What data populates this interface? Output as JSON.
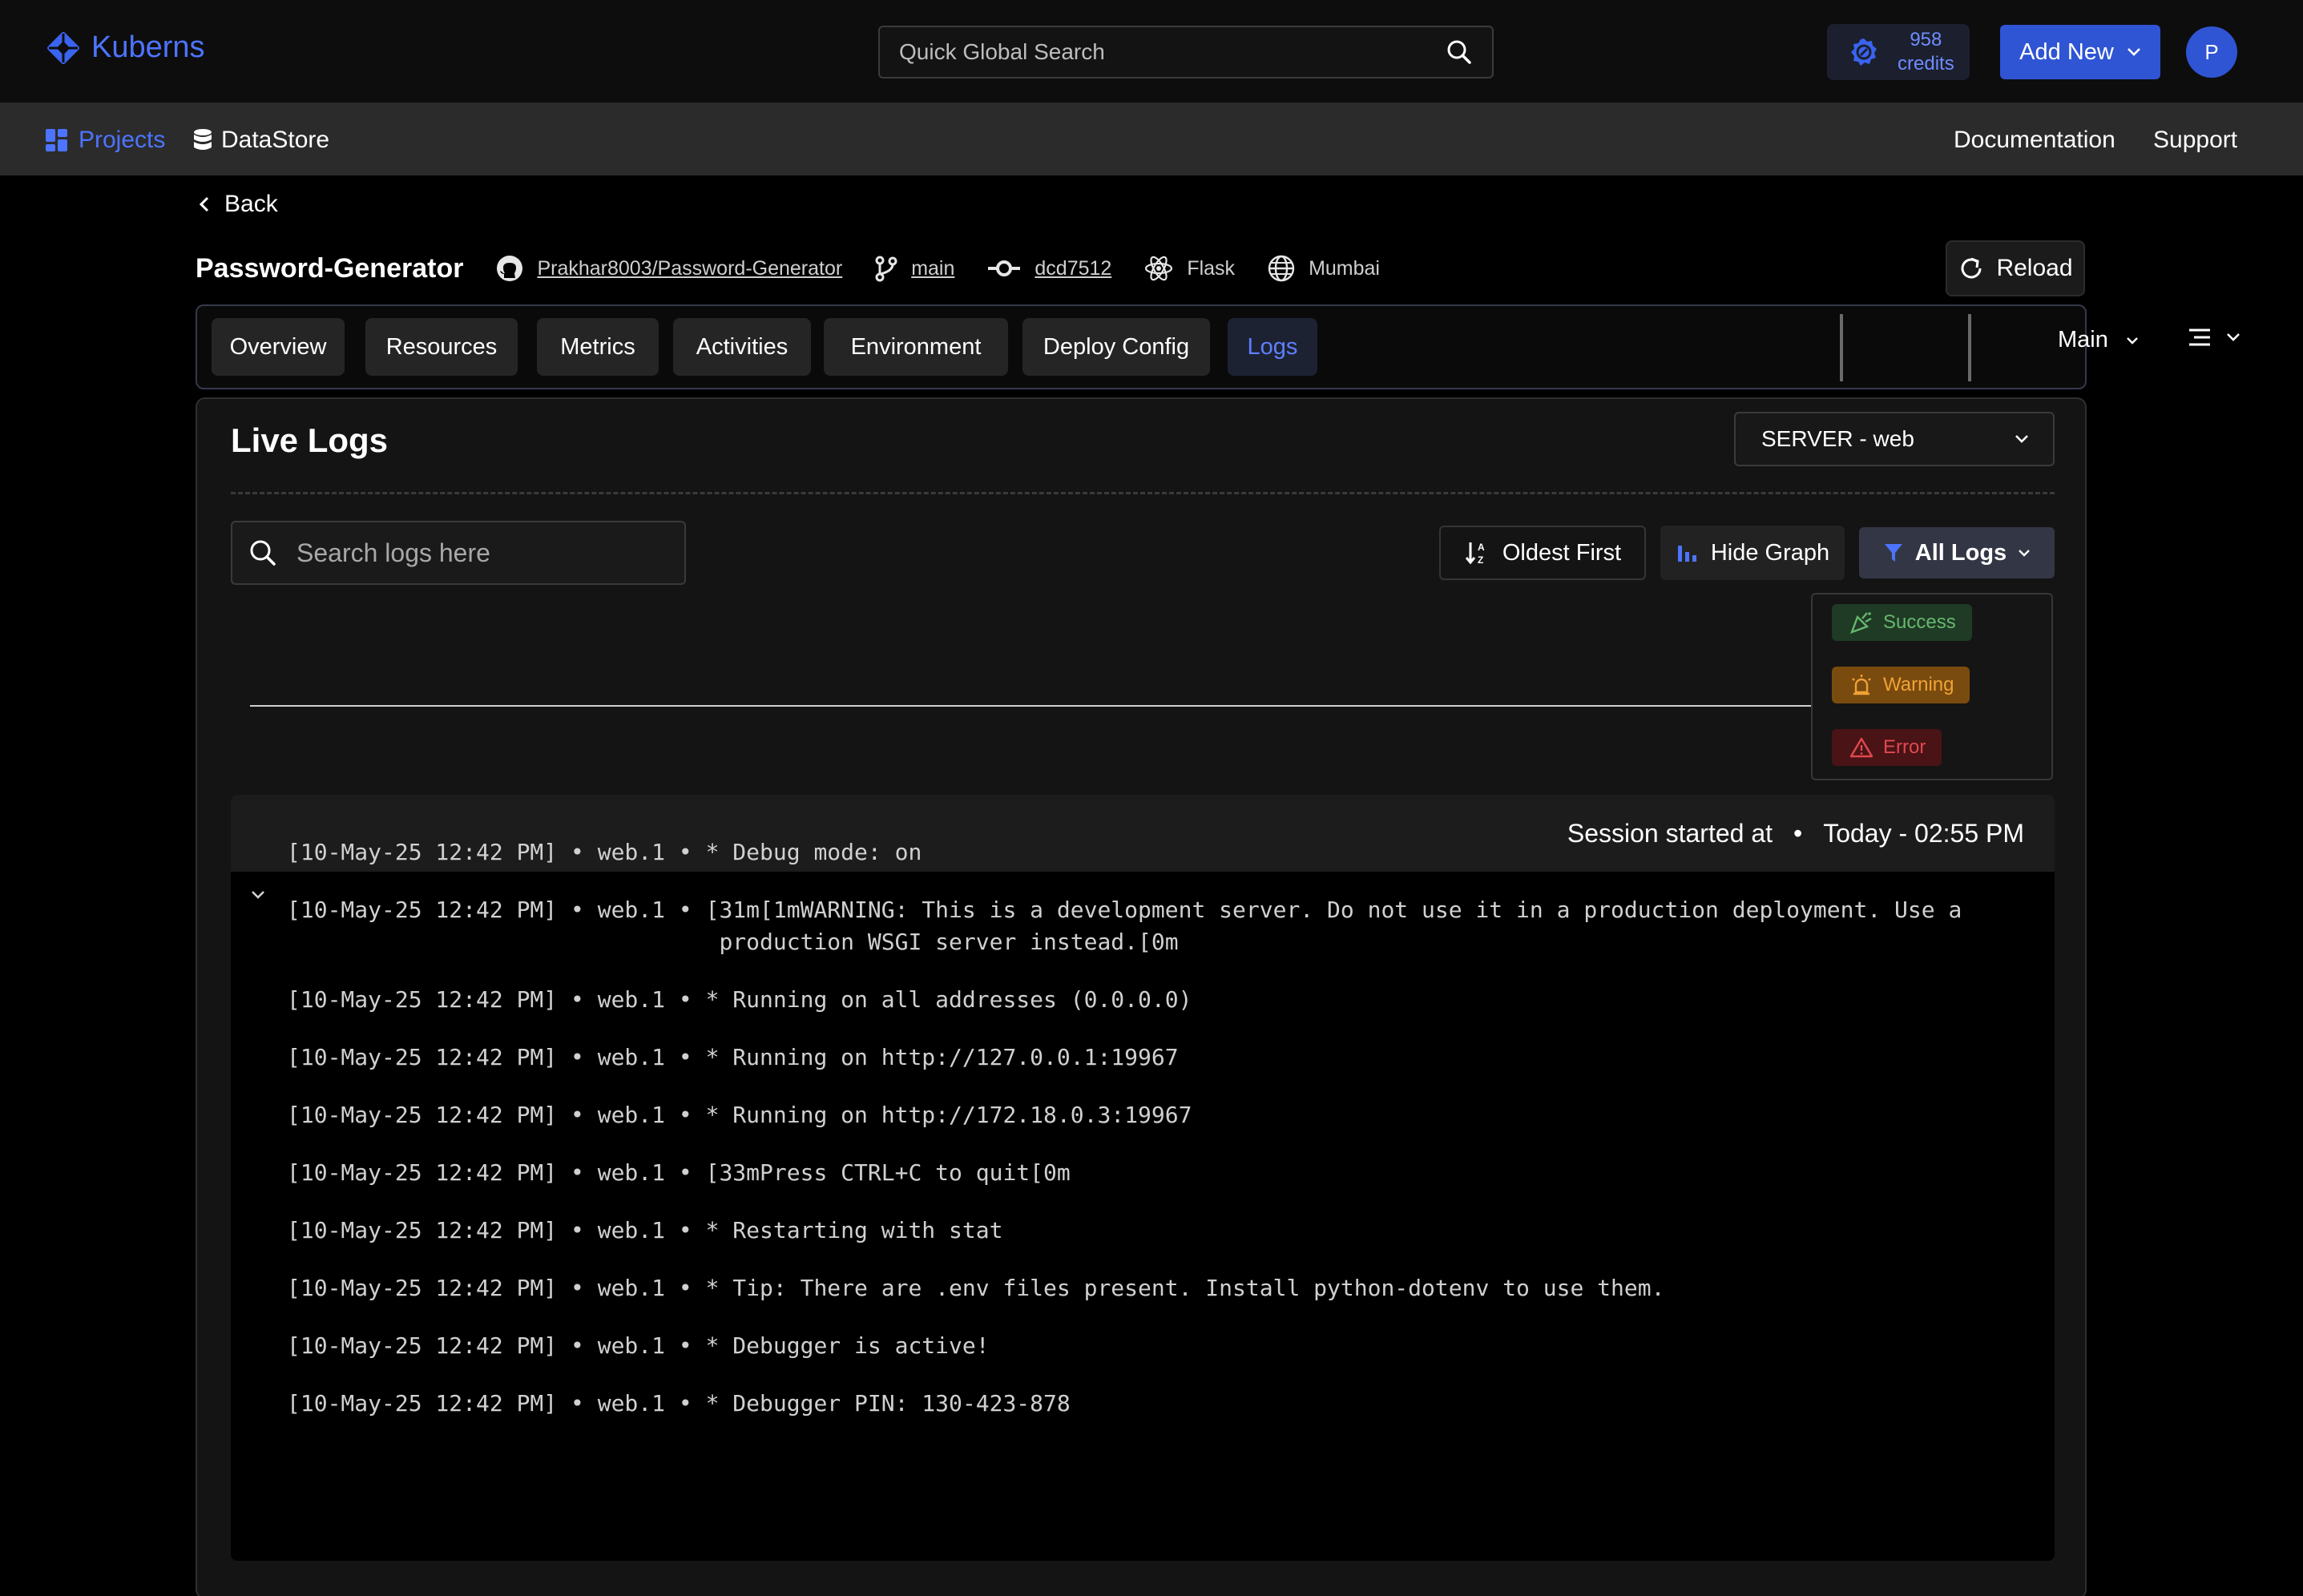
{
  "app": {
    "name": "Kuberns"
  },
  "header": {
    "search_placeholder": "Quick Global Search",
    "credits_amount": "958",
    "credits_label": "credits",
    "add_new_label": "Add New",
    "avatar_initial": "P"
  },
  "nav": {
    "projects_label": "Projects",
    "datastore_label": "DataStore",
    "documentation_label": "Documentation",
    "support_label": "Support"
  },
  "page": {
    "back_label": "Back",
    "project_name": "Password-Generator",
    "repo": "Prakhar8003/Password-Generator",
    "branch": "main",
    "commit": "dcd7512",
    "framework": "Flask",
    "region": "Mumbai",
    "reload_label": "Reload"
  },
  "tabs": [
    {
      "label": "Overview"
    },
    {
      "label": "Resources"
    },
    {
      "label": "Metrics"
    },
    {
      "label": "Activities"
    },
    {
      "label": "Environment"
    },
    {
      "label": "Deploy Config"
    },
    {
      "label": "Logs"
    }
  ],
  "environment_select": "Main",
  "logs": {
    "title": "Live Logs",
    "server_select": "SERVER - web",
    "search_placeholder": "Search logs here",
    "sort_label": "Oldest First",
    "graph_label": "Hide Graph",
    "filter_label": "All Logs",
    "filter_options": [
      {
        "label": "Success"
      },
      {
        "label": "Warning"
      },
      {
        "label": "Error"
      }
    ],
    "session_label": "Session started at",
    "session_time": "Today - 02:55 PM",
    "lines": [
      "[10-May-25 12:42 PM] • web.1 • * Debug mode: on",
      "[10-May-25 12:42 PM] • web.1 • [31m[1mWARNING: This is a development server. Do not use it in a production deployment. Use a\n                                production WSGI server instead.[0m",
      "[10-May-25 12:42 PM] • web.1 • * Running on all addresses (0.0.0.0)",
      "[10-May-25 12:42 PM] • web.1 • * Running on http://127.0.0.1:19967",
      "[10-May-25 12:42 PM] • web.1 • * Running on http://172.18.0.3:19967",
      "[10-May-25 12:42 PM] • web.1 • [33mPress CTRL+C to quit[0m",
      "[10-May-25 12:42 PM] • web.1 • * Restarting with stat",
      "[10-May-25 12:42 PM] • web.1 • * Tip: There are .env files present. Install python-dotenv to use them.",
      "[10-May-25 12:42 PM] • web.1 • * Debugger is active!",
      "[10-May-25 12:42 PM] • web.1 • * Debugger PIN: 130-423-878"
    ]
  },
  "icons": {
    "logo": "kuberns-logo-icon",
    "search": "search-icon",
    "credits": "credits-icon",
    "github": "github-icon",
    "branch": "git-branch-icon",
    "commit": "git-commit-icon",
    "framework": "react-atom-icon",
    "region": "globe-icon"
  },
  "colors": {
    "accent": "#2f55d4",
    "link": "#4d74ff",
    "success": "#66b86e",
    "warning": "#f0a336",
    "error": "#e0484f"
  }
}
